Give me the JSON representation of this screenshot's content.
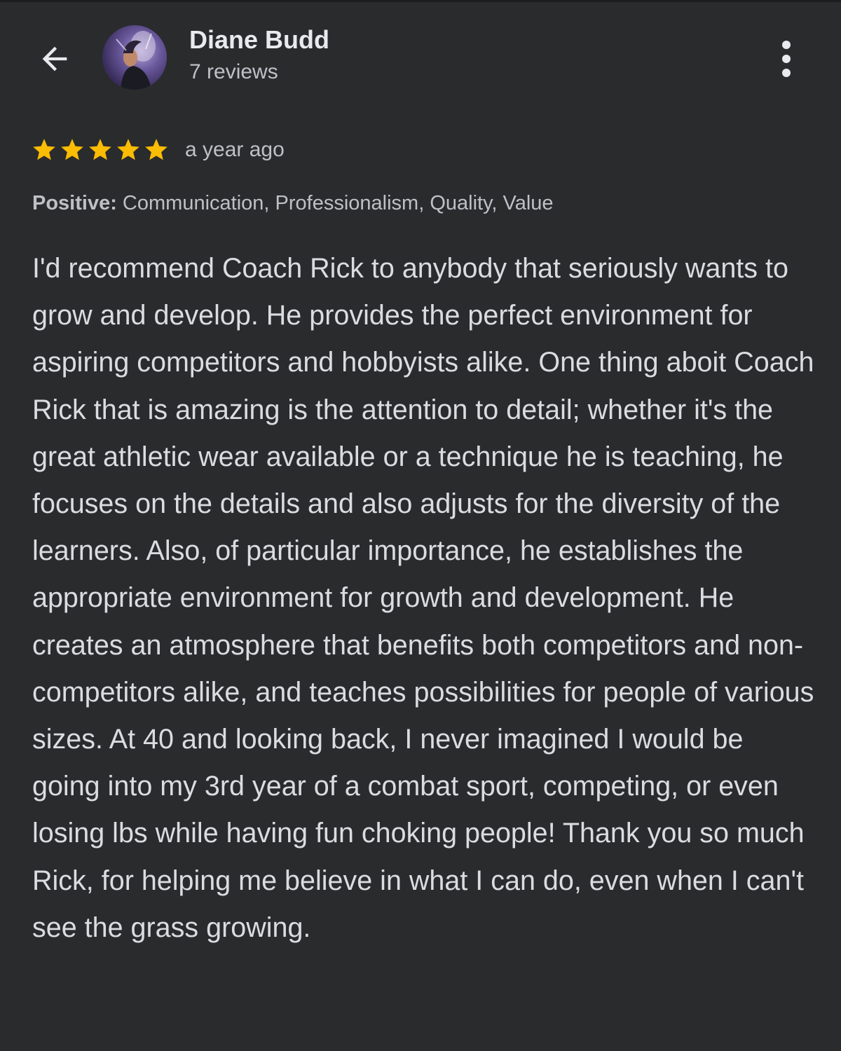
{
  "header": {
    "reviewer_name": "Diane Budd",
    "review_count": "7 reviews",
    "back_icon": "arrow-left-icon",
    "more_icon": "more-vert-icon"
  },
  "review": {
    "rating": 5,
    "rating_max": 5,
    "star_color": "#fbbc04",
    "date": "a year ago",
    "attributes_label": "Positive:",
    "attributes_value": " Communication, Professionalism, Quality, Value",
    "text": "I'd recommend Coach Rick to anybody that seriously wants to grow and develop. He provides the perfect environment for aspiring competitors and hobbyists alike. One thing aboit Coach Rick that is amazing is the attention to detail; whether it's the great athletic wear available or a technique he is teaching, he focuses on the details and also adjusts for the diversity of the learners. Also, of particular importance, he establishes the appropriate environment for growth and development. He creates an atmosphere that benefits both competitors and non-competitors alike, and teaches possibilities for people of various sizes. At 40 and looking back, I never imagined I would be going into my 3rd year of a combat sport, competing, or even losing lbs while having fun choking people! Thank you so much Rick, for helping me believe in what I can do, even when I can't see the grass growing."
  },
  "colors": {
    "background": "#2a2b2d",
    "primary_text": "#e8eaed",
    "secondary_text": "#bdc1c6"
  }
}
